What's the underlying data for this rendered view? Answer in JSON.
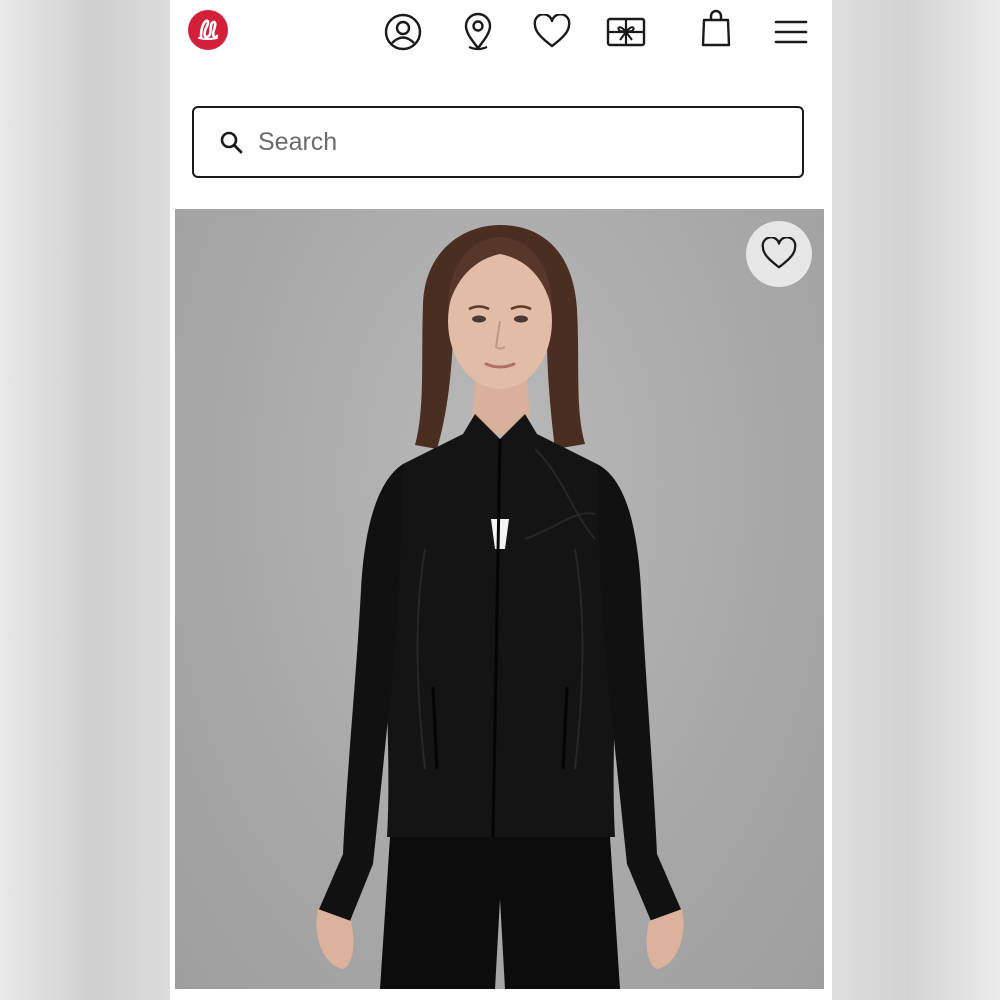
{
  "header": {
    "logo_icon": "lululemon-logo-icon",
    "brand_color": "#d31f3a",
    "icons": [
      "account-icon",
      "store-locator-icon",
      "wishlist-icon",
      "gift-card-icon",
      "shopping-bag-icon",
      "menu-icon"
    ]
  },
  "search": {
    "placeholder": "Search",
    "value": ""
  },
  "product": {
    "image": "model-wearing-black-zip-jacket",
    "favorite_icon": "heart-icon"
  }
}
